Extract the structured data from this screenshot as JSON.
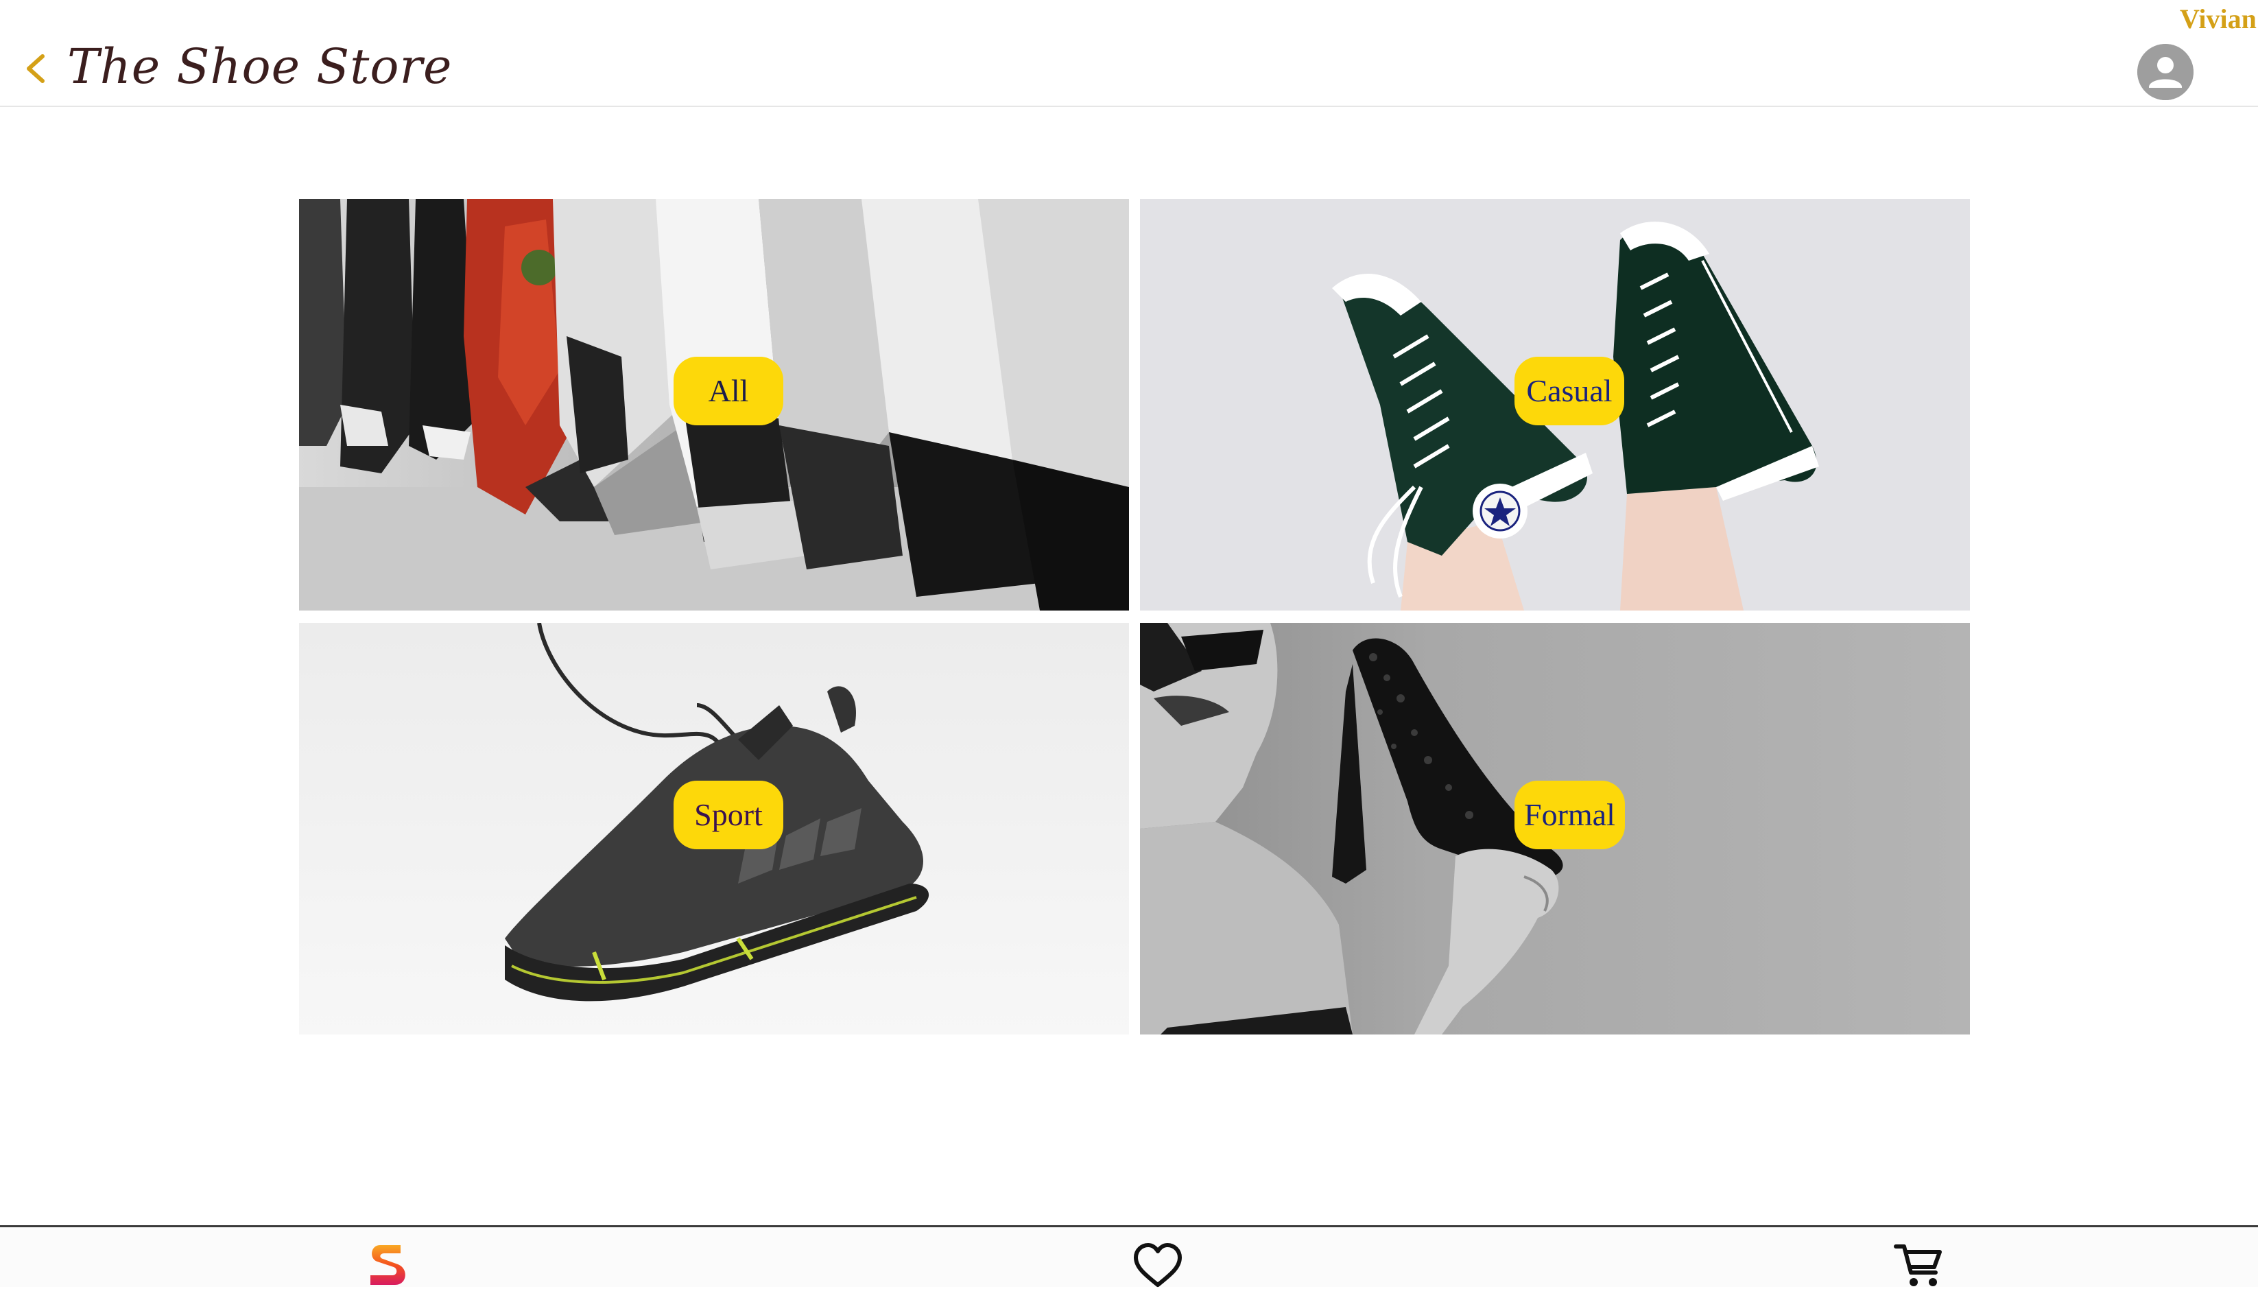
{
  "header": {
    "title": "The Shoe Store",
    "user_name": "Vivian",
    "back_icon": "chevron-left-icon",
    "avatar_icon": "account-circle-icon",
    "accent_color": "#d4a017",
    "title_color": "#3b1e1e"
  },
  "categories": [
    {
      "label": "All",
      "image": "row of sneakers on shelf"
    },
    {
      "label": "Casual",
      "image": "green high-top canvas sneakers"
    },
    {
      "label": "Sport",
      "image": "dark running shoe with laces"
    },
    {
      "label": "Formal",
      "image": "woman holding black glitter high heel"
    }
  ],
  "pill_color": "#fdd80a",
  "bottom_nav": {
    "items": [
      {
        "icon": "store-logo-icon"
      },
      {
        "icon": "heart-icon"
      },
      {
        "icon": "cart-icon"
      }
    ]
  }
}
